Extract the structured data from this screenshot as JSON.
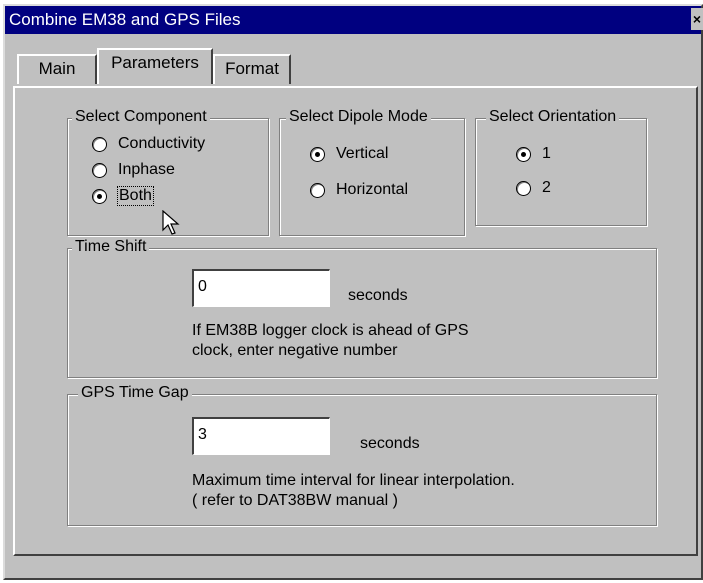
{
  "window": {
    "title": "Combine EM38 and GPS Files",
    "close_label": "×"
  },
  "tabs": [
    {
      "label": "Main"
    },
    {
      "label": "Parameters"
    },
    {
      "label": "Format"
    }
  ],
  "component": {
    "legend": "Select Component",
    "options": [
      "Conductivity",
      "Inphase",
      "Both"
    ],
    "selected": "Both"
  },
  "dipole": {
    "legend": "Select Dipole Mode",
    "options": [
      "Vertical",
      "Horizontal"
    ],
    "selected": "Vertical"
  },
  "orientation": {
    "legend": "Select Orientation",
    "options": [
      "1",
      "2"
    ],
    "selected": "1"
  },
  "time_shift": {
    "legend": "Time Shift",
    "value": "0",
    "unit": "seconds",
    "note_line1": "If EM38B logger clock is ahead of GPS",
    "note_line2": "clock, enter negative number"
  },
  "gps_gap": {
    "legend": "GPS Time Gap",
    "value": "3",
    "unit": "seconds",
    "note_line1": "Maximum time interval for linear interpolation.",
    "note_line2": "( refer to DAT38BW manual )"
  }
}
